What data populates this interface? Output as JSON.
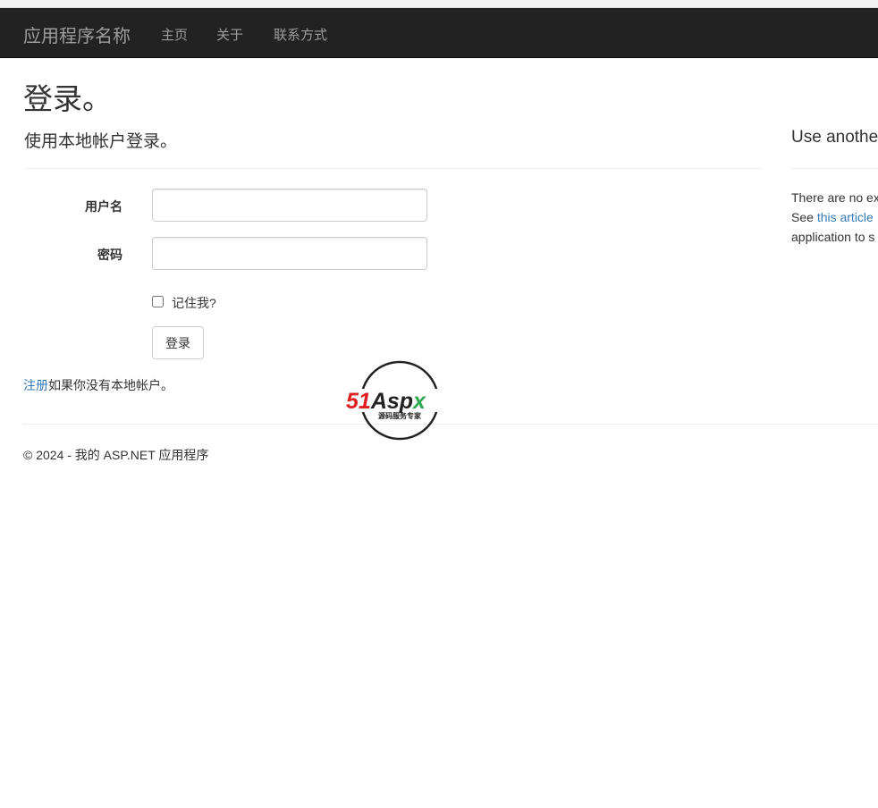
{
  "navbar": {
    "brand": "应用程序名称",
    "links": [
      "主页",
      "关于",
      "联系方式"
    ]
  },
  "page": {
    "title": "登录。"
  },
  "local_login": {
    "heading": "使用本地帐户登录。",
    "username_label": "用户名",
    "username_value": "",
    "password_label": "密码",
    "password_value": "",
    "remember_label": "记住我?",
    "remember_checked": false,
    "submit_label": "登录",
    "register_link": "注册",
    "register_suffix": "如果你没有本地帐户。"
  },
  "external_login": {
    "heading": "Use anothe",
    "line1": "There are no ex",
    "line2_prefix": "See ",
    "line2_link": "this article",
    "line3": "application to s"
  },
  "footer": {
    "text": "© 2024 - 我的 ASP.NET 应用程序"
  },
  "watermark": {
    "logo_text_red": "51",
    "logo_text_dark": "Asp",
    "logo_text_green": "x",
    "tagline": "源码服务专家"
  },
  "colors": {
    "navbar_bg": "#222222",
    "navbar_text": "#9d9d9d",
    "link": "#337ab7",
    "watermark_red": "#e02020",
    "watermark_green": "#2fa84f"
  }
}
